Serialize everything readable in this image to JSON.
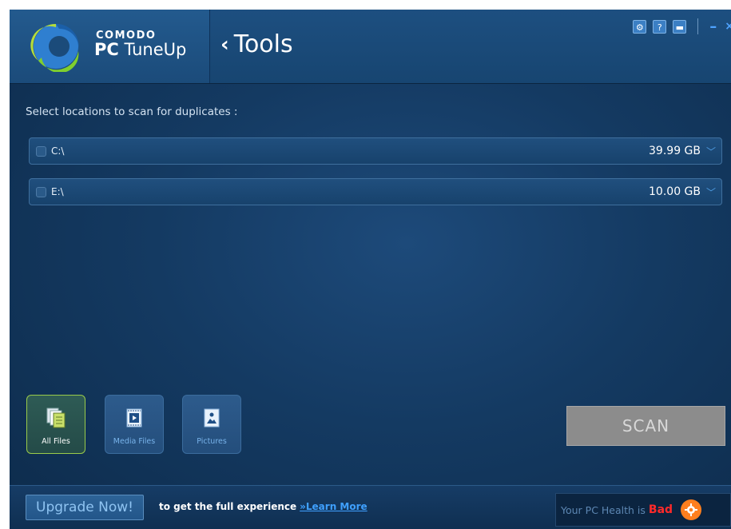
{
  "app": {
    "brand_top": "COMODO",
    "brand_name_bold": "PC",
    "brand_name_rest": " TuneUp",
    "section_title": "Tools",
    "back_glyph": "‹"
  },
  "title_bar": {
    "icons": [
      "gear-icon",
      "help-icon",
      "chat-icon"
    ],
    "minimize_glyph": "–",
    "close_glyph": "×"
  },
  "main": {
    "prompt": "Select locations to scan for duplicates :",
    "drives": [
      {
        "label": "C:\\",
        "size": "39.99 GB",
        "checked": false
      },
      {
        "label": "E:\\",
        "size": "10.00 GB",
        "checked": false
      }
    ],
    "file_types": [
      {
        "label": "All Files",
        "icon": "all-files-icon",
        "selected": true
      },
      {
        "label": "Media Files",
        "icon": "media-files-icon",
        "selected": false
      },
      {
        "label": "Pictures",
        "icon": "pictures-icon",
        "selected": false
      }
    ],
    "scan_label": "SCAN"
  },
  "footer": {
    "upgrade_label": "Upgrade Now!",
    "promo_text": "to get the full experience",
    "learn_more": "»Learn More",
    "health_label": "Your PC Health is",
    "health_value": "Bad"
  },
  "colors": {
    "accent": "#3fa0ff",
    "health_bad": "#ff2a2a",
    "selected_border": "#9acb4a"
  }
}
